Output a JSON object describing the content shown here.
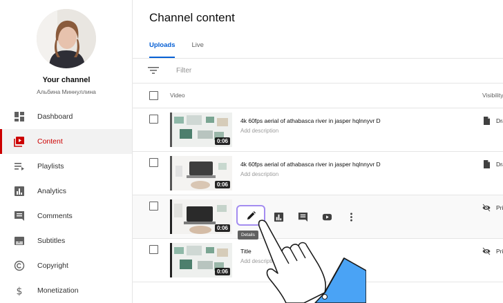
{
  "sidebar": {
    "channel_title": "Your channel",
    "channel_name": "Альбина Миннуллина",
    "items": [
      {
        "label": "Dashboard",
        "icon": "dashboard-icon"
      },
      {
        "label": "Content",
        "icon": "content-icon",
        "active": true
      },
      {
        "label": "Playlists",
        "icon": "playlists-icon"
      },
      {
        "label": "Analytics",
        "icon": "analytics-icon"
      },
      {
        "label": "Comments",
        "icon": "comments-icon"
      },
      {
        "label": "Subtitles",
        "icon": "subtitles-icon"
      },
      {
        "label": "Copyright",
        "icon": "copyright-icon"
      },
      {
        "label": "Monetization",
        "icon": "monetization-icon"
      }
    ]
  },
  "main": {
    "title": "Channel content",
    "tabs": [
      {
        "label": "Uploads",
        "active": true
      },
      {
        "label": "Live"
      }
    ],
    "filter": {
      "placeholder": "Filter"
    },
    "columns": {
      "video": "Video",
      "visibility": "Visibility"
    },
    "rows": [
      {
        "title": "4k 60fps aerial of athabasca river in jasper hqlnnyvr D",
        "description": "Add description",
        "duration": "0:06",
        "visibility": "Draft",
        "visibility_icon": "draft-icon"
      },
      {
        "title": "4k 60fps aerial of athabasca river in jasper hqlnnyvr D",
        "description": "Add description",
        "duration": "0:06",
        "visibility": "Draft",
        "visibility_icon": "draft-icon"
      },
      {
        "title": "",
        "description": "",
        "duration": "0:06",
        "visibility": "Private",
        "visibility_icon": "private-icon"
      },
      {
        "title": "Title",
        "description": "Add description",
        "duration": "0:06",
        "visibility": "Private",
        "visibility_icon": "private-icon"
      }
    ],
    "row_actions": {
      "details_tooltip": "Details"
    }
  },
  "colors": {
    "accent": "#065fd4",
    "active_red": "#cc0000",
    "highlight": "#a38cf0",
    "hand_cuff": "#4aa3f5"
  }
}
